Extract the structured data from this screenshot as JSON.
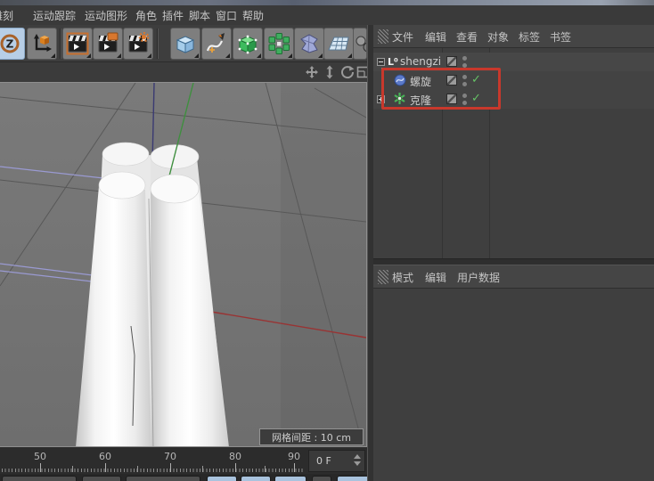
{
  "menu_bar": {
    "items": [
      "雕刻",
      "运动跟踪",
      "运动图形",
      "角色",
      "插件",
      "脚本",
      "窗口",
      "帮助"
    ]
  },
  "toolbar": {
    "icons": [
      "zoom-z-tool",
      "move-axis-tool",
      "motion-tracker-clip-frame",
      "motion-tracker-clip-rect",
      "motion-tracker-clip-gear",
      "cube-primitive",
      "spline-pen",
      "subdivision-surface",
      "mograph-cloner",
      "deformer",
      "floor-grid",
      "simulation-gears"
    ]
  },
  "viewport": {
    "grid_label": "网格间距 : 10 cm",
    "nav_icons": [
      "pan-icon",
      "dolly-icon",
      "rotate-icon",
      "maximize-icon"
    ]
  },
  "object_manager": {
    "menu": [
      "文件",
      "编辑",
      "查看",
      "对象",
      "标签",
      "书签"
    ],
    "objects": [
      {
        "icon_glyph": "L⁰",
        "icon": "null-object-icon",
        "label": "shengzi"
      },
      {
        "icon": "helix-spline-icon",
        "label": "螺旋",
        "enabled_mark": "✓"
      },
      {
        "icon": "cloner-icon",
        "label": "克隆",
        "enabled_mark": "✓"
      }
    ],
    "highlight_color": "#c8382c"
  },
  "attribute_manager": {
    "menu": [
      "模式",
      "编辑",
      "用户数据"
    ]
  },
  "timeline": {
    "tick_labels": [
      "50",
      "60",
      "70",
      "80",
      "90"
    ],
    "frame_value": "0 F"
  }
}
